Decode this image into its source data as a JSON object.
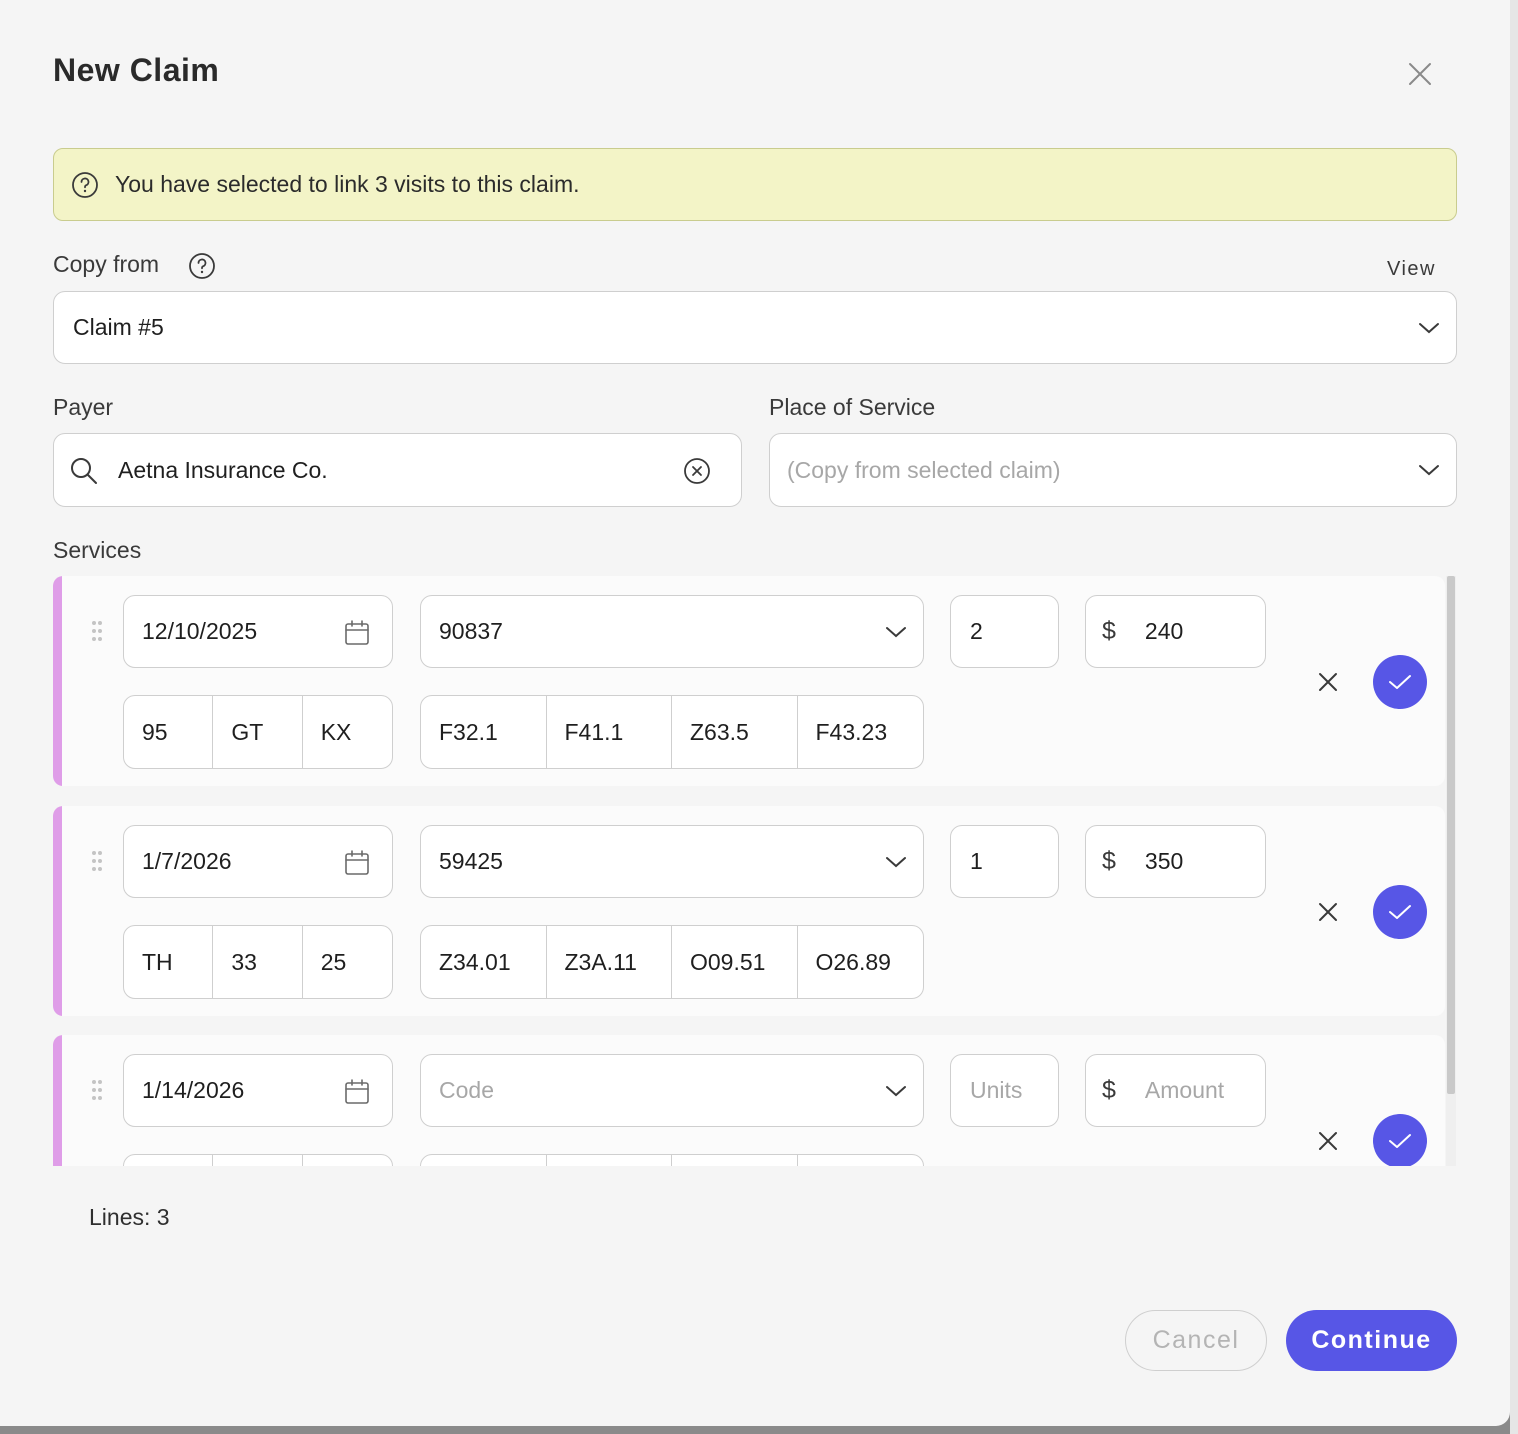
{
  "dialog": {
    "title": "New Claim",
    "banner_text": "You have selected to link 3 visits to this claim.",
    "copy_from": {
      "label": "Copy from",
      "view_link": "View",
      "value": "Claim #5"
    },
    "payer": {
      "label": "Payer",
      "value": "Aetna Insurance Co."
    },
    "place_of_service": {
      "label": "Place of Service",
      "placeholder": "(Copy from selected claim)"
    },
    "services_label": "Services",
    "placeholders": {
      "code": "Code",
      "units": "Units",
      "amount": "Amount"
    },
    "currency_symbol": "$",
    "lines": [
      {
        "date": "12/10/2025",
        "code": "90837",
        "units": "2",
        "amount": "240",
        "modifiers": [
          "95",
          "GT",
          "KX"
        ],
        "diagnoses": [
          "F32.1",
          "F41.1",
          "Z63.5",
          "F43.23"
        ]
      },
      {
        "date": "1/7/2026",
        "code": "59425",
        "units": "1",
        "amount": "350",
        "modifiers": [
          "TH",
          "33",
          "25"
        ],
        "diagnoses": [
          "Z34.01",
          "Z3A.11",
          "O09.51",
          "O26.89"
        ]
      },
      {
        "date": "1/14/2026",
        "code": "",
        "units": "",
        "amount": "",
        "modifiers": [
          "",
          "",
          ""
        ],
        "diagnoses": [
          "",
          "",
          "",
          ""
        ]
      }
    ],
    "lines_count": "Lines: 3",
    "cancel_label": "Cancel",
    "continue_label": "Continue"
  },
  "colors": {
    "accent": "#5756e6",
    "banner_bg": "#f3f4c7",
    "row_accent": "#df9de8"
  }
}
